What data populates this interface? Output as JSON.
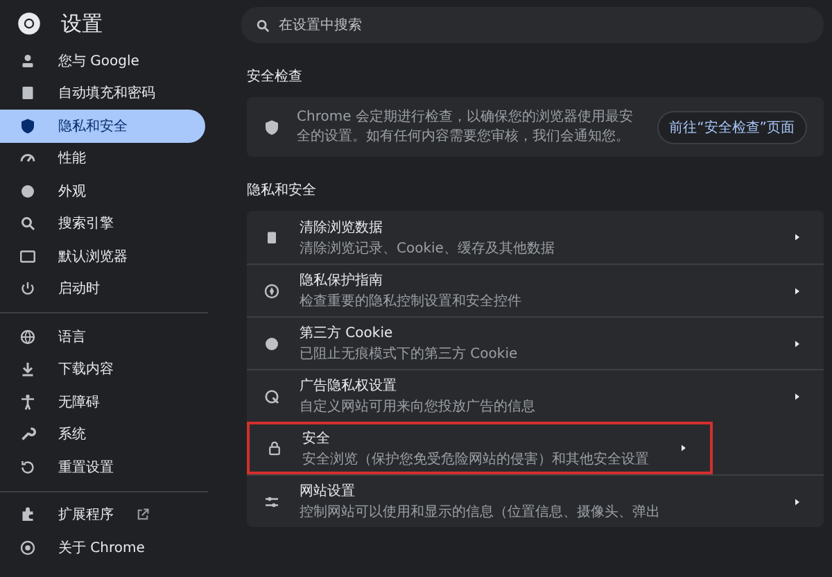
{
  "header": {
    "title": "设置"
  },
  "search": {
    "placeholder": "在设置中搜索"
  },
  "sidebar": {
    "groups": [
      [
        {
          "label": "您与 Google",
          "selected": false
        },
        {
          "label": "自动填充和密码",
          "selected": false
        },
        {
          "label": "隐私和安全",
          "selected": true
        },
        {
          "label": "性能",
          "selected": false
        },
        {
          "label": "外观",
          "selected": false
        },
        {
          "label": "搜索引擎",
          "selected": false
        },
        {
          "label": "默认浏览器",
          "selected": false
        },
        {
          "label": "启动时",
          "selected": false
        }
      ],
      [
        {
          "label": "语言",
          "selected": false
        },
        {
          "label": "下载内容",
          "selected": false
        },
        {
          "label": "无障碍",
          "selected": false
        },
        {
          "label": "系统",
          "selected": false
        },
        {
          "label": "重置设置",
          "selected": false
        }
      ],
      [
        {
          "label": "扩展程序",
          "selected": false
        },
        {
          "label": "关于 Chrome",
          "selected": false
        }
      ]
    ]
  },
  "safety_check": {
    "heading": "安全检查",
    "text": "Chrome 会定期进行检查，以确保您的浏览器使用最安全的设置。如有任何内容需要您审核，我们会通知您。",
    "button": "前往“安全检查”页面"
  },
  "privacy": {
    "heading": "隐私和安全",
    "rows": [
      {
        "title": "清除浏览数据",
        "subtitle": "清除浏览记录、Cookie、缓存及其他数据",
        "highlighted": false
      },
      {
        "title": "隐私保护指南",
        "subtitle": "检查重要的隐私控制设置和安全控件",
        "highlighted": false
      },
      {
        "title": "第三方 Cookie",
        "subtitle": "已阻止无痕模式下的第三方 Cookie",
        "highlighted": false
      },
      {
        "title": "广告隐私权设置",
        "subtitle": "自定义网站可用来向您投放广告的信息",
        "highlighted": false
      },
      {
        "title": "安全",
        "subtitle": "安全浏览（保护您免受危险网站的侵害）和其他安全设置",
        "highlighted": true
      },
      {
        "title": "网站设置",
        "subtitle": "控制网站可以使用和显示的信息（位置信息、摄像头、弹出",
        "highlighted": false
      }
    ]
  }
}
